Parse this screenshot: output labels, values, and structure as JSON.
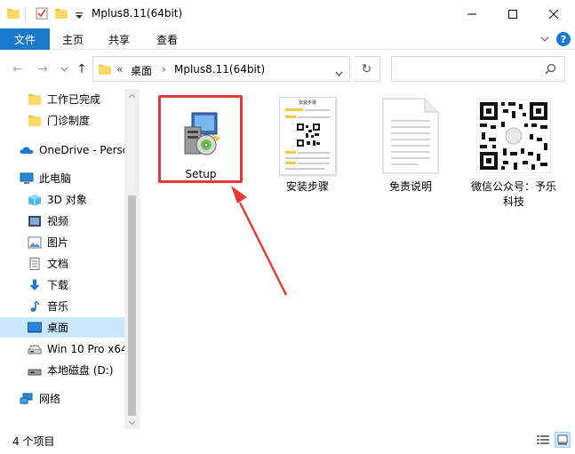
{
  "window": {
    "title": "Mplus8.11(64bit)",
    "minimize_glyph": "—",
    "maximize_glyph": "☐",
    "close_glyph": "✕"
  },
  "ribbon": {
    "file_tab": "文件",
    "tabs": [
      "主页",
      "共享",
      "查看"
    ],
    "help_glyph": "?"
  },
  "address": {
    "back_glyph": "←",
    "forward_glyph": "→",
    "recent_glyph": "⌄",
    "up_glyph": "↑",
    "overflow": "«",
    "crumbs": [
      "桌面",
      "Mplus8.11(64bit)"
    ],
    "separator": "›",
    "refresh_glyph": "↻",
    "search_placeholder": ""
  },
  "sidebar": {
    "items": [
      {
        "label": "工作已完成",
        "icon": "folder-icon"
      },
      {
        "label": "门诊制度",
        "icon": "folder-icon"
      },
      {
        "label": "OneDrive - Perso",
        "icon": "cloud-icon"
      },
      {
        "label": "此电脑",
        "icon": "computer-icon"
      },
      {
        "label": "3D 对象",
        "icon": "3d-objects-icon"
      },
      {
        "label": "视频",
        "icon": "video-icon"
      },
      {
        "label": "图片",
        "icon": "pictures-icon"
      },
      {
        "label": "文档",
        "icon": "documents-icon"
      },
      {
        "label": "下载",
        "icon": "download-icon"
      },
      {
        "label": "音乐",
        "icon": "music-icon"
      },
      {
        "label": "桌面",
        "icon": "desktop-icon"
      },
      {
        "label": "Win 10 Pro x64",
        "icon": "drive-icon"
      },
      {
        "label": "本地磁盘 (D:)",
        "icon": "drive-icon"
      },
      {
        "label": "网络",
        "icon": "network-icon"
      }
    ]
  },
  "files": [
    {
      "label": "Setup",
      "icon": "installer-icon"
    },
    {
      "label": "安装步骤",
      "icon": "image-thumbnail-icon"
    },
    {
      "label": "免责说明",
      "icon": "text-document-icon"
    },
    {
      "label": "微信公众号：予乐科技",
      "icon": "qr-code-icon"
    }
  ],
  "thumbnail": {
    "heading": "安装步骤"
  },
  "status": {
    "item_count": "4 个项目"
  },
  "colors": {
    "accent": "#1979ca",
    "selection": "#cce8ff",
    "highlight_box": "#e53935",
    "arrow": "#e53935",
    "folder": "#f5c342"
  }
}
